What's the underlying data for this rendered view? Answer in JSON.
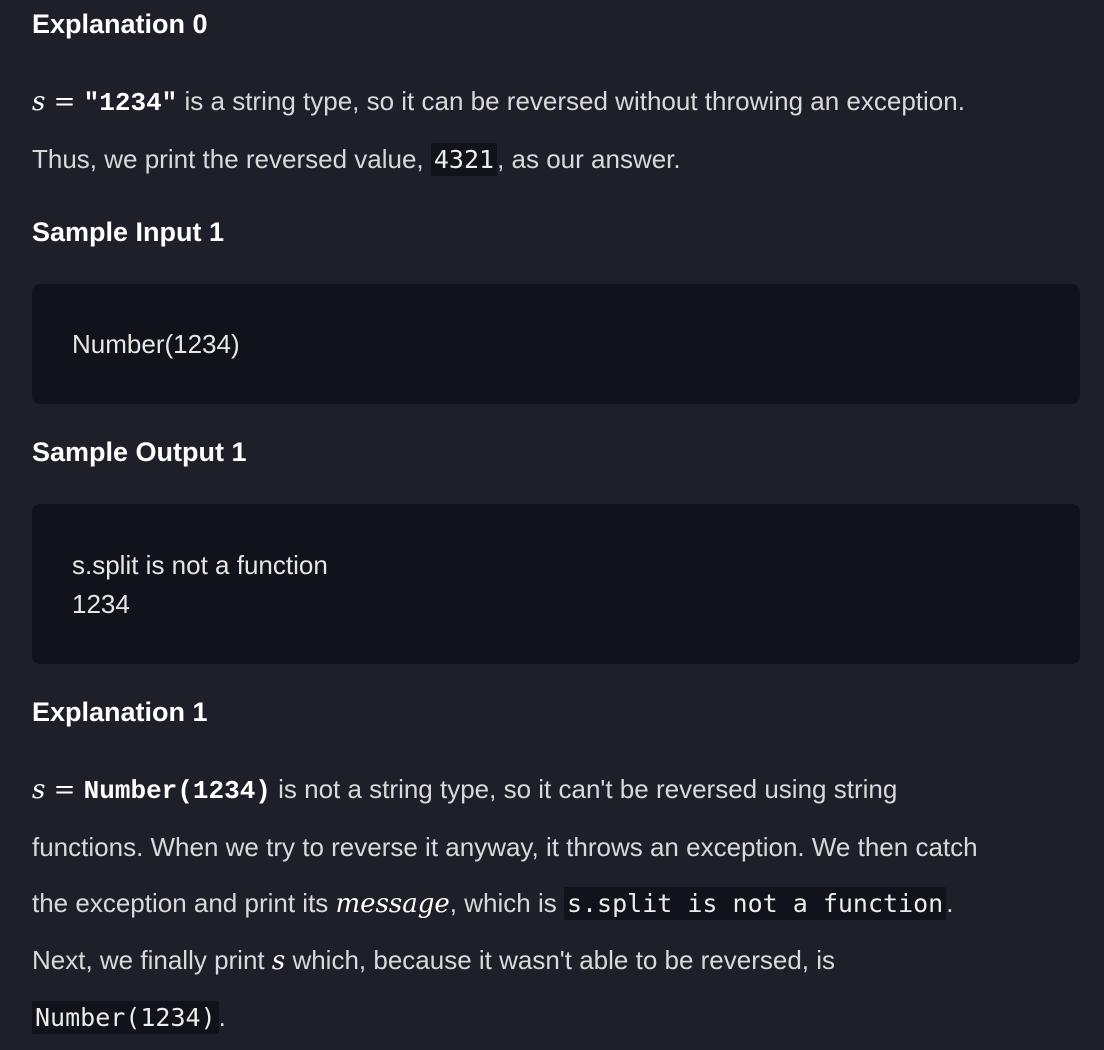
{
  "explanation0": {
    "heading": "Explanation 0",
    "line1": {
      "var": "s",
      "eq": " = ",
      "value": "\"1234\"",
      "rest": " is a string type, so it can be reversed without throwing an exception."
    },
    "line2": {
      "before": "Thus, we print the reversed value, ",
      "code": "4321",
      "after": ", as our answer."
    }
  },
  "sample_input_1": {
    "heading": "Sample Input 1",
    "lines": [
      "Number(1234)"
    ]
  },
  "sample_output_1": {
    "heading": "Sample Output 1",
    "lines": [
      "s.split is not a function",
      "1234"
    ]
  },
  "explanation1": {
    "heading": "Explanation 1",
    "line1": {
      "var": "s",
      "eq": " = ",
      "value": "Number(1234)",
      "rest": " is not a string type, so it can't be reversed using string"
    },
    "line2": "functions. When we try to reverse it anyway, it throws an exception. We then catch",
    "line3": {
      "before": "the exception and print its ",
      "math": "message",
      "middle": ", which is ",
      "code": "s.split is not a function",
      "after": "."
    },
    "line4": {
      "before": "Next, we finally print ",
      "var": "s",
      "after": " which, because it wasn't able to be reversed, is"
    },
    "line5": {
      "code": "Number(1234)",
      "after": "."
    }
  }
}
